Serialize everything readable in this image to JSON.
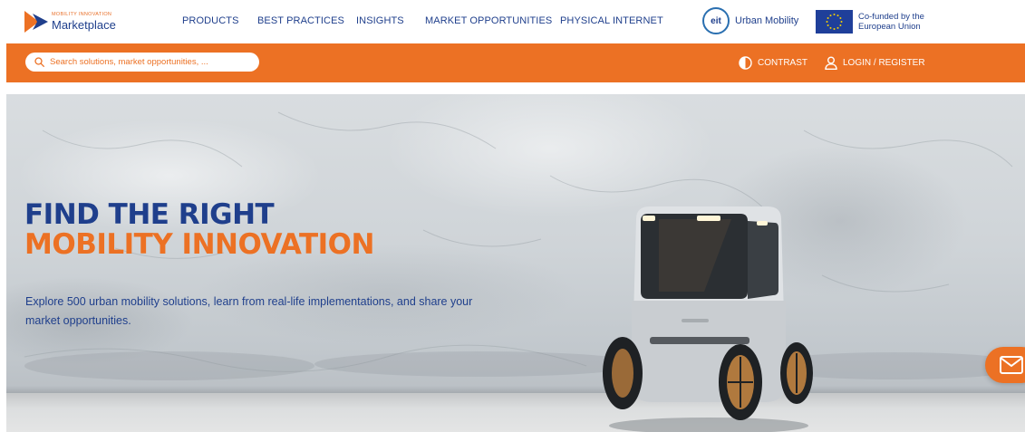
{
  "brand": {
    "logo_small": "MOBILITY INNOVATION",
    "logo_big": "Marketplace",
    "orange": "#ec7124",
    "navy": "#1f3f8c"
  },
  "nav": {
    "items": [
      {
        "label": "PRODUCTS"
      },
      {
        "label": "BEST PRACTICES"
      },
      {
        "label": "INSIGHTS"
      },
      {
        "label": "MARKET OPPORTUNITIES"
      },
      {
        "label": "PHYSICAL INTERNET"
      }
    ]
  },
  "partners": {
    "eit_mark": "eit",
    "eit_label": "Urban Mobility",
    "eu_line1": "Co-funded by the",
    "eu_line2": "European Union"
  },
  "toolbar": {
    "search_placeholder": "Search solutions, market opportunities, ...",
    "search_icon": "search-icon",
    "contrast_label": "CONTRAST",
    "contrast_icon": "contrast-icon",
    "login_label": "LOGIN / REGISTER",
    "login_icon": "user-icon"
  },
  "hero": {
    "title_line1": "FIND THE RIGHT",
    "title_line2": "MOBILITY INNOVATION",
    "subtitle": "Explore 500 urban mobility solutions, learn from real-life implementations, and share your market opportunities."
  },
  "fab": {
    "icon": "mail-icon"
  }
}
